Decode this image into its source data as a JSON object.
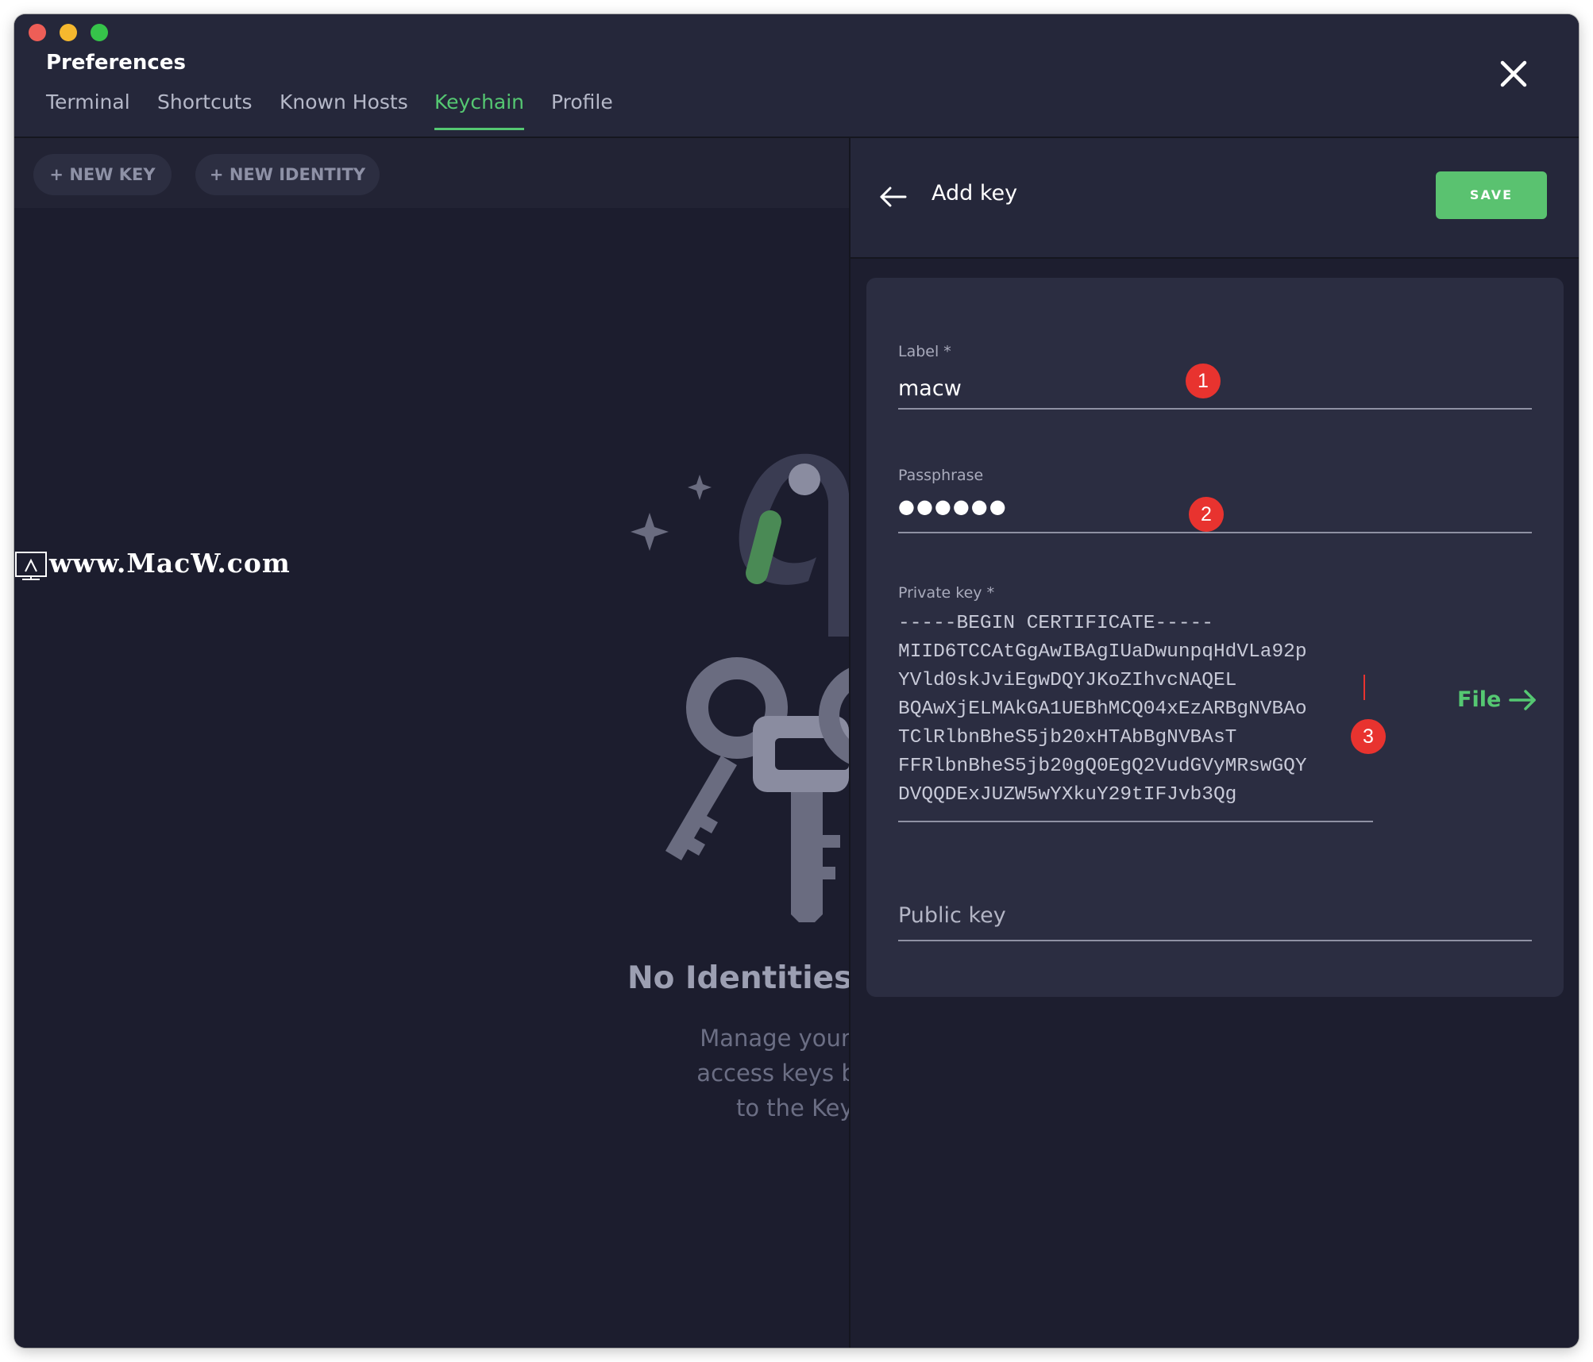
{
  "window": {
    "title": "Preferences",
    "tabs": [
      {
        "label": "Terminal",
        "active": false
      },
      {
        "label": "Shortcuts",
        "active": false
      },
      {
        "label": "Known Hosts",
        "active": false
      },
      {
        "label": "Keychain",
        "active": true
      },
      {
        "label": "Profile",
        "active": false
      }
    ],
    "close_icon": "close-icon"
  },
  "toolbar": {
    "new_key_label": "+ NEW KEY",
    "new_identity_label": "+ NEW IDENTITY"
  },
  "empty_state": {
    "title": "No Identities",
    "description_lines": [
      "Manage your userr",
      "access keys by add",
      "to the Keych"
    ],
    "illustration_icon": "keyring-icon"
  },
  "watermark": {
    "text": "www.MacW.com"
  },
  "add_key": {
    "header_title": "Add key",
    "back_icon": "arrow-left-icon",
    "save_label": "SAVE",
    "label_field": {
      "label": "Label *",
      "value": "macw"
    },
    "passphrase_field": {
      "label": "Passphrase",
      "value": "●●●●●●"
    },
    "private_key_field": {
      "label": "Private key *",
      "value": "-----BEGIN CERTIFICATE-----\nMIID6TCCAtGgAwIBAgIUaDwunpqHdVLa92p\nYVld0skJviEgwDQYJKoZIhvcNAQEL\nBQAwXjELMAkGA1UEBhMCQ04xEzARBgNVBAo\nTClRlbnBheS5jb20xHTAbBgNVBAsT\nFFRlbnBheS5jb20gQ0EgQ2VudGVyMRswGQY\nDVQQDExJUZW5wYXkuY29tIFJvb3Qg"
    },
    "file_button": {
      "label": "File",
      "icon": "arrow-right-icon"
    },
    "public_key_field": {
      "placeholder": "Public key"
    }
  },
  "annotations": [
    "1",
    "2",
    "3"
  ],
  "colors": {
    "accent_green": "#55c872",
    "save_green": "#5ac270",
    "badge_red": "#e8332f",
    "background": "#1c1d2e",
    "panel": "#2b2d41"
  }
}
